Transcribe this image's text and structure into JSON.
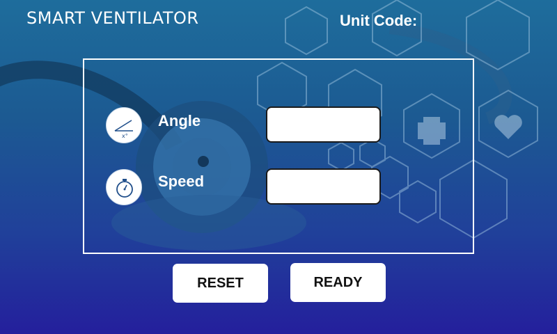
{
  "header": {
    "title": "SMART VENTILATOR",
    "unit_code_label": "Unit Code:"
  },
  "form": {
    "angle": {
      "label": "Angle",
      "icon": "angle-icon",
      "icon_text": "x°",
      "value": ""
    },
    "speed": {
      "label": "Speed",
      "icon": "stopwatch-icon",
      "value": ""
    }
  },
  "actions": {
    "reset_label": "RESET",
    "ready_label": "READY"
  },
  "colors": {
    "background_top": "#1e6d9c",
    "background_bottom": "#241f9c",
    "text": "#ffffff",
    "button_bg": "#ffffff",
    "icon_stroke": "#1f4e8a"
  }
}
